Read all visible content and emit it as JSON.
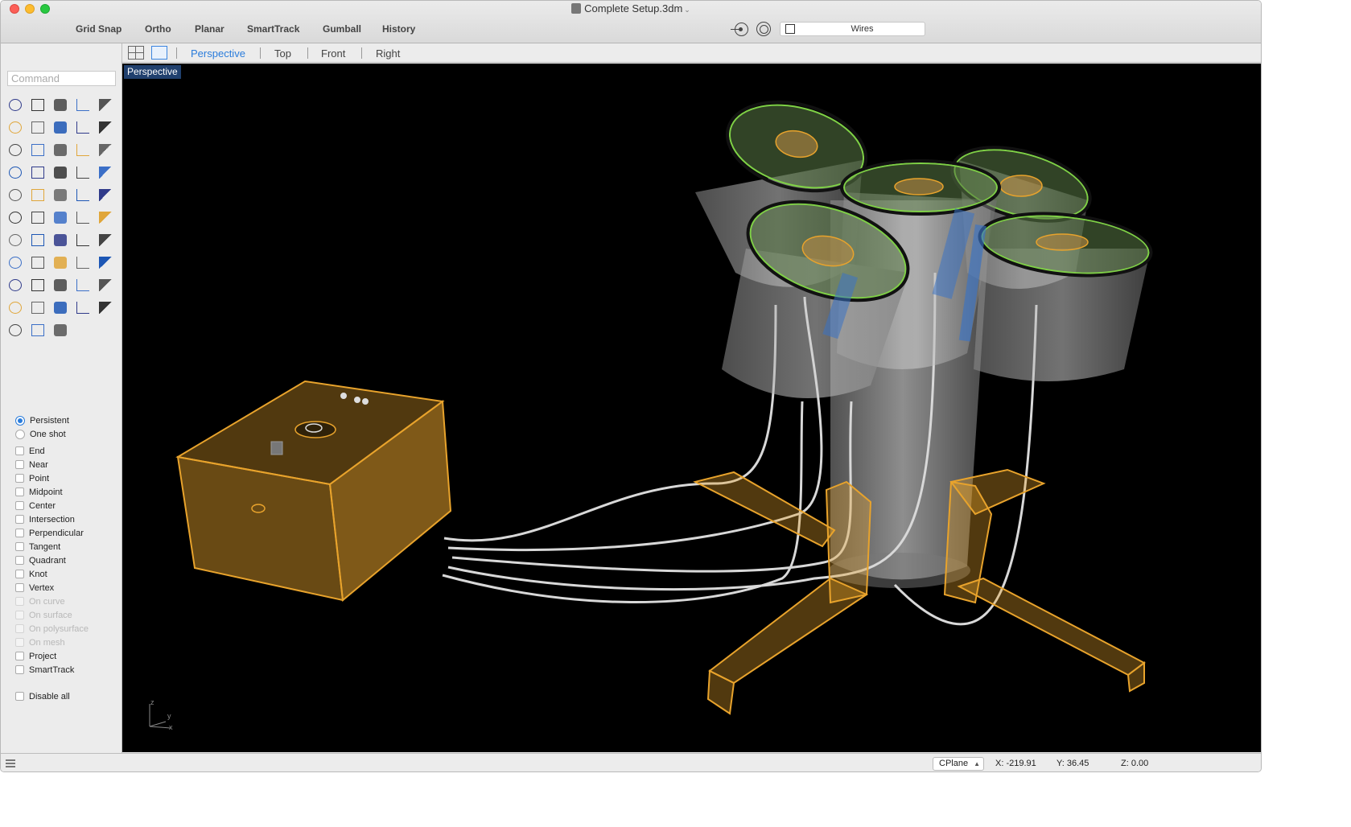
{
  "window": {
    "title": "Complete Setup.3dm"
  },
  "toolbar": {
    "buttons": [
      "Grid Snap",
      "Ortho",
      "Planar",
      "SmartTrack",
      "Gumball",
      "History"
    ],
    "display_mode": "Wires"
  },
  "command": {
    "placeholder": "Command"
  },
  "viewport_tabs": [
    "Perspective",
    "Top",
    "Front",
    "Right"
  ],
  "active_viewport": "Perspective",
  "tools": [
    "select-arrow-icon",
    "point-icon",
    "polyline-icon",
    "curve-icon",
    "circle-icon",
    "ellipse-icon",
    "arc-icon",
    "rectangle-icon",
    "polygon-icon",
    "fillet-curve-icon",
    "surface-corner-icon",
    "extrude-curve-icon",
    "box-icon",
    "sphere-icon",
    "cylinder-icon",
    "plane-surface-icon",
    "gear-icon",
    "explode-icon",
    "trim-icon",
    "split-icon",
    "boolean-union-icon",
    "group-icon",
    "rebuild-icon",
    "offset-icon",
    "text-icon",
    "move-icon",
    "array-icon",
    "scale-icon",
    "box-edit-icon",
    "dimension-icon",
    "grid-array-icon",
    "align-icon",
    "edit-points-icon",
    "check-icon",
    "analyze-icon",
    "paint-icon",
    "zoom-icon",
    "zoom-window-icon",
    "zoom-extents-icon",
    "zoom-selected-icon",
    "rotate-view-icon",
    "car-icon",
    "terrain-icon",
    "properties-icon",
    "light-icon",
    "lock-icon",
    "material-icon",
    "color-wheel-icon",
    "render-sphere-icon",
    "environment-icon",
    "render-icon",
    "camera-icon",
    "snapshot-icon"
  ],
  "snap_mode": [
    {
      "label": "Persistent",
      "selected": true
    },
    {
      "label": "One shot",
      "selected": false
    }
  ],
  "osnaps": [
    {
      "label": "End",
      "enabled": true
    },
    {
      "label": "Near",
      "enabled": true
    },
    {
      "label": "Point",
      "enabled": true
    },
    {
      "label": "Midpoint",
      "enabled": true
    },
    {
      "label": "Center",
      "enabled": true
    },
    {
      "label": "Intersection",
      "enabled": true
    },
    {
      "label": "Perpendicular",
      "enabled": true
    },
    {
      "label": "Tangent",
      "enabled": true
    },
    {
      "label": "Quadrant",
      "enabled": true
    },
    {
      "label": "Knot",
      "enabled": true
    },
    {
      "label": "Vertex",
      "enabled": true
    },
    {
      "label": "On curve",
      "enabled": false
    },
    {
      "label": "On surface",
      "enabled": false
    },
    {
      "label": "On polysurface",
      "enabled": false
    },
    {
      "label": "On mesh",
      "enabled": false
    },
    {
      "label": "Project",
      "enabled": true
    },
    {
      "label": "SmartTrack",
      "enabled": true
    }
  ],
  "disable_all_label": "Disable all",
  "axis": {
    "z": "z",
    "y": "y",
    "x": "x"
  },
  "status": {
    "cplane": "CPlane",
    "x": "X: -219.91",
    "y": "Y: 36.45",
    "z": "Z: 0.00"
  },
  "colors": {
    "accent": "#2a7cdb",
    "viewport_bg": "#000000",
    "box_orange": "#e8a32c",
    "wire": "#d8d8d8",
    "drum_rim": "#7fd146"
  }
}
